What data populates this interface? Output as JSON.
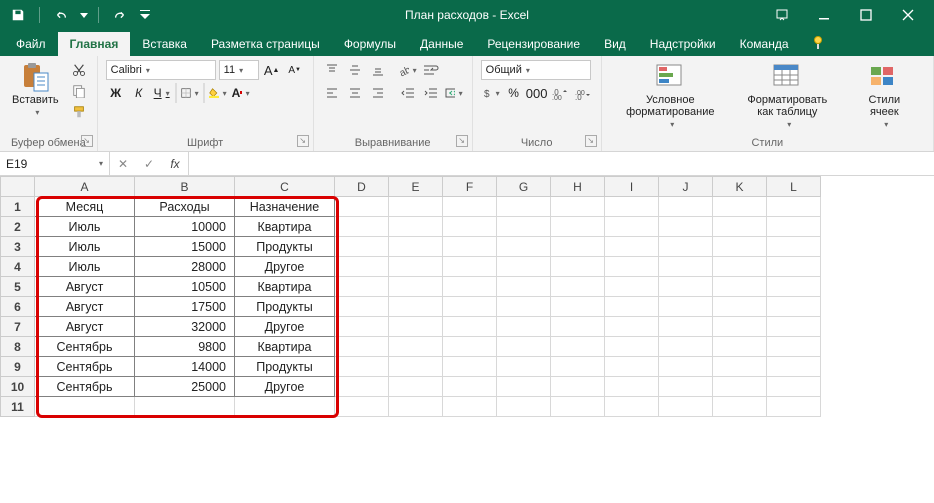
{
  "title": "План расходов - Excel",
  "tabs": {
    "file": "Файл",
    "home": "Главная",
    "insert": "Вставка",
    "layout": "Разметка страницы",
    "formulas": "Формулы",
    "data": "Данные",
    "review": "Рецензирование",
    "view": "Вид",
    "addins": "Надстройки",
    "team": "Команда"
  },
  "ribbon": {
    "paste": "Вставить",
    "clipboard_group": "Буфер обмена",
    "font_name": "Calibri",
    "font_size": "11",
    "font_group": "Шрифт",
    "bold": "Ж",
    "italic": "К",
    "underline": "Ч",
    "align_group": "Выравнивание",
    "number_format": "Общий",
    "number_group": "Число",
    "cond_fmt": "Условное форматирование",
    "fmt_table": "Форматировать как таблицу",
    "cell_styles": "Стили ячеек",
    "styles_group": "Стили"
  },
  "namebox": "E19",
  "fx": "fx",
  "columns": [
    "A",
    "B",
    "C",
    "D",
    "E",
    "F",
    "G",
    "H",
    "I",
    "J",
    "K",
    "L"
  ],
  "rows": [
    "1",
    "2",
    "3",
    "4",
    "5",
    "6",
    "7",
    "8",
    "9",
    "10",
    "11"
  ],
  "headers": {
    "a": "Месяц",
    "b": "Расходы",
    "c": "Назначение"
  },
  "data": [
    {
      "a": "Июль",
      "b": "10000",
      "c": "Квартира"
    },
    {
      "a": "Июль",
      "b": "15000",
      "c": "Продукты"
    },
    {
      "a": "Июль",
      "b": "28000",
      "c": "Другое"
    },
    {
      "a": "Август",
      "b": "10500",
      "c": "Квартира"
    },
    {
      "a": "Август",
      "b": "17500",
      "c": "Продукты"
    },
    {
      "a": "Август",
      "b": "32000",
      "c": "Другое"
    },
    {
      "a": "Сентябрь",
      "b": "9800",
      "c": "Квартира"
    },
    {
      "a": "Сентябрь",
      "b": "14000",
      "c": "Продукты"
    },
    {
      "a": "Сентябрь",
      "b": "25000",
      "c": "Другое"
    }
  ]
}
